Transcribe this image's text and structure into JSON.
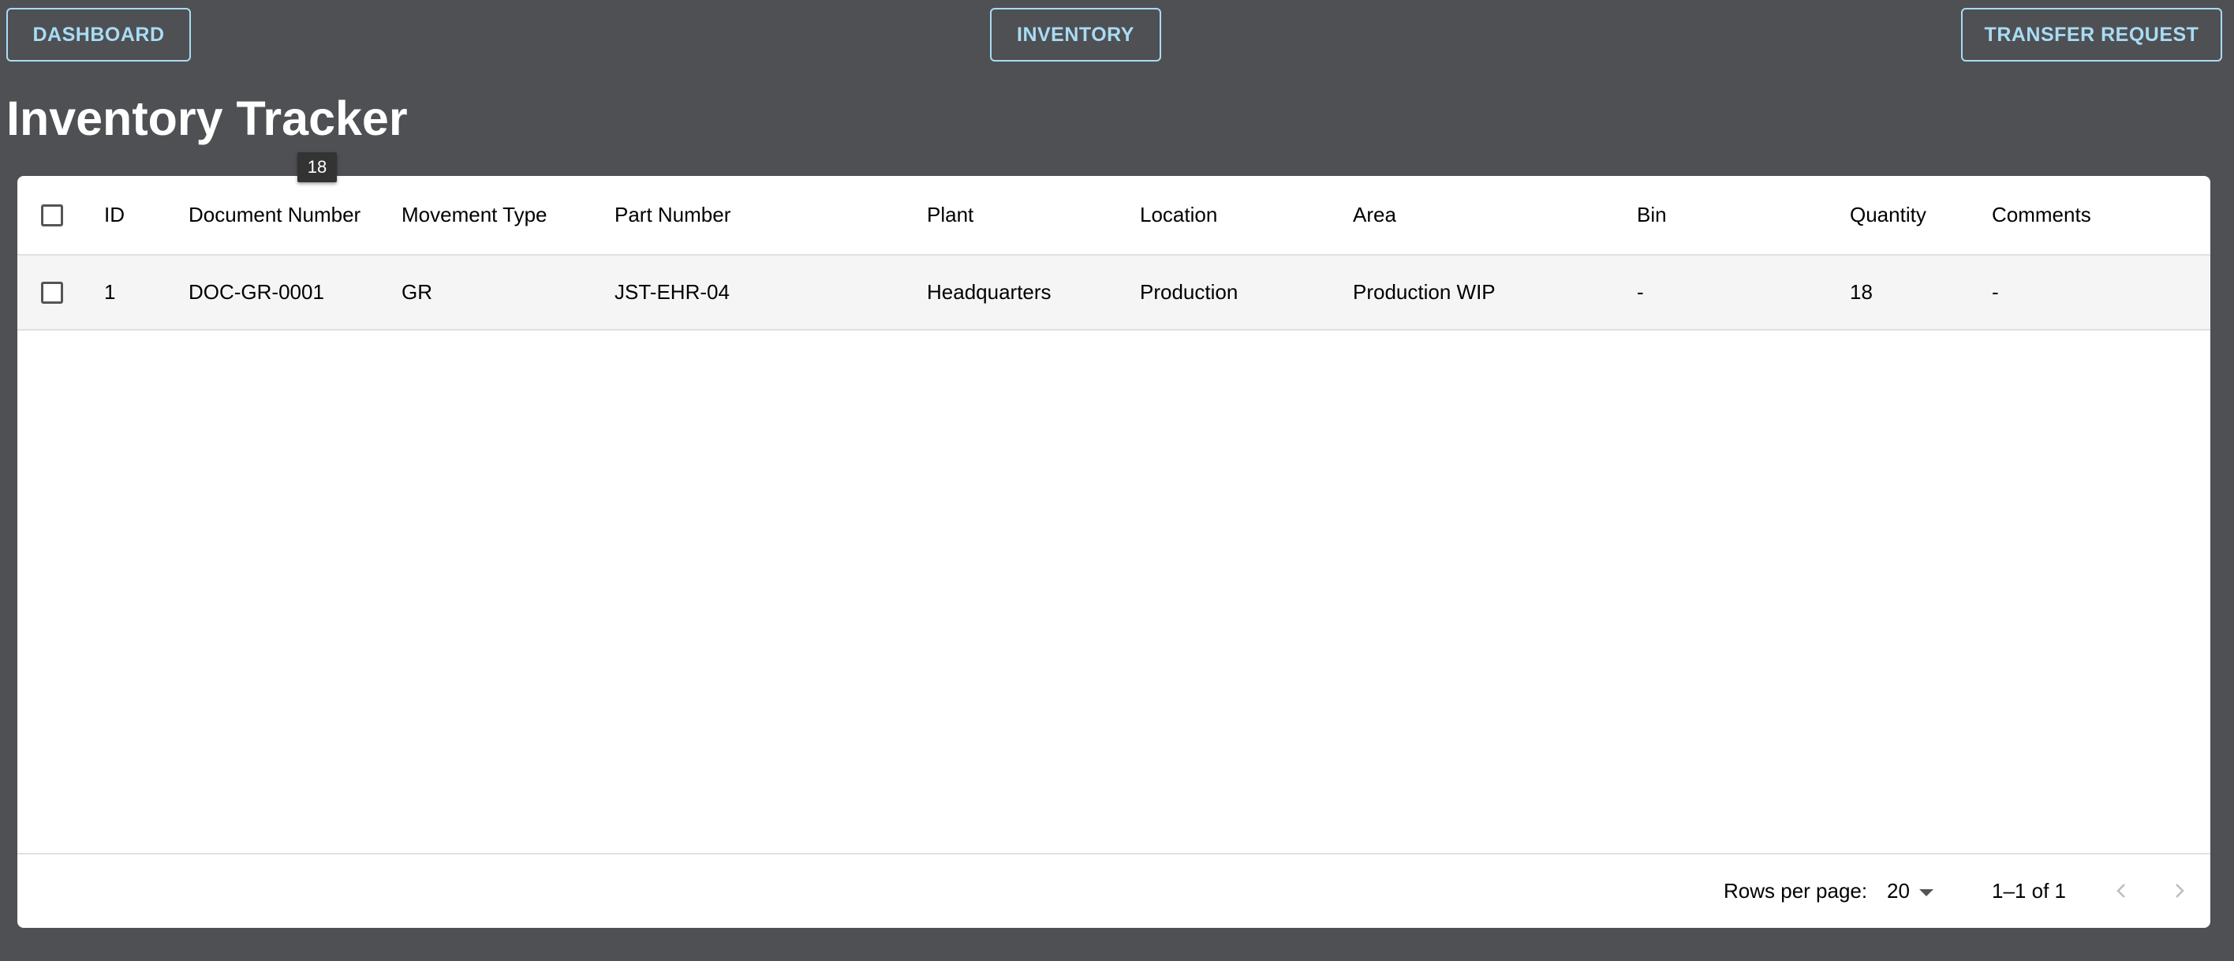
{
  "nav": {
    "dashboard": "DASHBOARD",
    "inventory": "INVENTORY",
    "transfer_request": "TRANSFER REQUEST"
  },
  "page": {
    "title": "Inventory Tracker"
  },
  "tooltip": {
    "text": "18"
  },
  "table": {
    "columns": [
      "ID",
      "Document Number",
      "Movement Type",
      "Part Number",
      "Plant",
      "Location",
      "Area",
      "Bin",
      "Quantity",
      "Comments"
    ],
    "rows": [
      [
        "1",
        "DOC-GR-0001",
        "GR",
        "JST-EHR-04",
        "Headquarters",
        "Production",
        "Production WIP",
        "-",
        "18",
        "-"
      ]
    ]
  },
  "footer": {
    "rows_per_page_label": "Rows per page:",
    "rows_per_page_value": "20",
    "range_text": "1–1 of 1"
  },
  "icons": {
    "prev": "chevron-left-icon",
    "next": "chevron-right-icon",
    "dropdown": "caret-down-icon"
  },
  "colors": {
    "background": "#4f5053",
    "accent": "#a8dcf5",
    "surface": "#ffffff",
    "row_highlight": "#f5f5f5"
  }
}
